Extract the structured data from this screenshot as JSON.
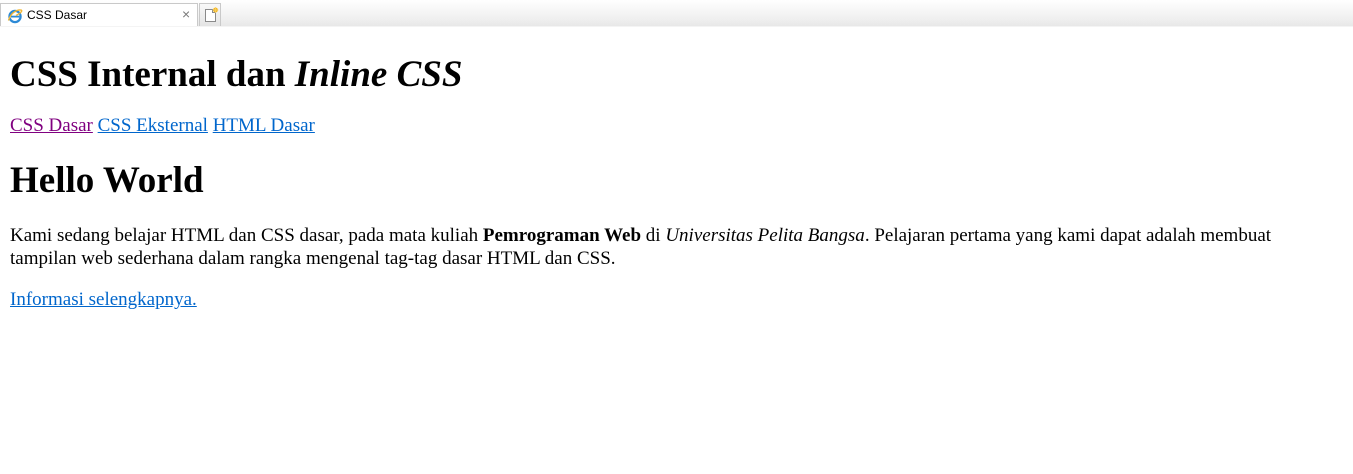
{
  "browser": {
    "tab_title": "CSS Dasar",
    "tab_icon": "ie-browser-icon",
    "close_symbol": "×",
    "new_tab_icon": "new-tab-icon"
  },
  "page": {
    "title_normal": "CSS Internal dan ",
    "title_italic": "Inline CSS",
    "nav_links": [
      {
        "label": "CSS Dasar",
        "visited": true
      },
      {
        "label": "CSS Eksternal",
        "visited": false
      },
      {
        "label": "HTML Dasar",
        "visited": false
      }
    ],
    "heading": "Hello World",
    "paragraph": {
      "part1": "Kami sedang belajar HTML dan CSS dasar, pada mata kuliah ",
      "bold": "Pemrograman Web",
      "part2": " di ",
      "italic": "Universitas Pelita Bangsa",
      "part3": ". Pelajaran pertama yang kami dapat adalah membuat tampilan web sederhana dalam rangka mengenal tag-tag dasar HTML dan CSS."
    },
    "more_link": "Informasi selengkapnya."
  },
  "colors": {
    "link": "#0066cc",
    "visited_link": "#800080",
    "text": "#000000"
  }
}
